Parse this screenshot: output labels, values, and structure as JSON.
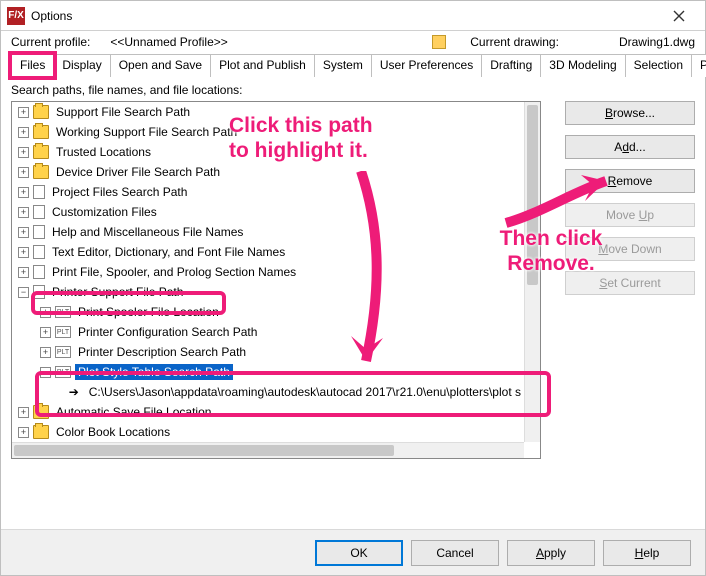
{
  "window": {
    "title": "Options"
  },
  "profile": {
    "current_label": "Current profile:",
    "current_value": "<<Unnamed Profile>>",
    "drawing_label": "Current drawing:",
    "drawing_value": "Drawing1.dwg"
  },
  "tabs": [
    "Files",
    "Display",
    "Open and Save",
    "Plot and Publish",
    "System",
    "User Preferences",
    "Drafting",
    "3D Modeling",
    "Selection",
    "Profiles"
  ],
  "panel_label": "Search paths, file names, and file locations:",
  "tree": [
    {
      "i": 0,
      "exp": "+",
      "icon": "folder",
      "label": "Support File Search Path"
    },
    {
      "i": 0,
      "exp": "+",
      "icon": "folder",
      "label": "Working Support File Search Path"
    },
    {
      "i": 0,
      "exp": "+",
      "icon": "folder",
      "label": "Trusted Locations"
    },
    {
      "i": 0,
      "exp": "+",
      "icon": "folder",
      "label": "Device Driver File Search Path"
    },
    {
      "i": 0,
      "exp": "+",
      "icon": "doc",
      "label": "Project Files Search Path"
    },
    {
      "i": 0,
      "exp": "+",
      "icon": "doc",
      "label": "Customization Files"
    },
    {
      "i": 0,
      "exp": "+",
      "icon": "doc",
      "label": "Help and Miscellaneous File Names"
    },
    {
      "i": 0,
      "exp": "+",
      "icon": "doc",
      "label": "Text Editor, Dictionary, and Font File Names"
    },
    {
      "i": 0,
      "exp": "+",
      "icon": "doc",
      "label": "Print File, Spooler, and Prolog Section Names"
    },
    {
      "i": 0,
      "exp": "-",
      "icon": "doc",
      "label": "Printer Support File Path",
      "hl": true
    },
    {
      "i": 1,
      "exp": "+",
      "icon": "plt",
      "label": "Print Spooler File Location"
    },
    {
      "i": 1,
      "exp": "+",
      "icon": "plt",
      "label": "Printer Configuration Search Path"
    },
    {
      "i": 1,
      "exp": "+",
      "icon": "plt",
      "label": "Printer Description Search Path"
    },
    {
      "i": 1,
      "exp": "-",
      "icon": "plt",
      "label": "Plot Style Table Search Path",
      "sel": true
    },
    {
      "i": 2,
      "exp": "",
      "icon": "arrow",
      "label": "C:\\Users\\Jason\\appdata\\roaming\\autodesk\\autocad 2017\\r21.0\\enu\\plotters\\plot s"
    },
    {
      "i": 0,
      "exp": "+",
      "icon": "folder",
      "label": "Automatic Save File Location"
    },
    {
      "i": 0,
      "exp": "+",
      "icon": "folder",
      "label": "Color Book Locations"
    }
  ],
  "buttons": {
    "browse": "Browse...",
    "add": "Add...",
    "remove": "Remove",
    "moveup": "Move Up",
    "movedown": "Move Down",
    "setcurrent": "Set Current"
  },
  "bottom": {
    "ok": "OK",
    "cancel": "Cancel",
    "apply": "Apply",
    "help": "Help"
  },
  "annotations": {
    "a1": "Click this path to highlight it.",
    "a2": "Then click Remove."
  }
}
